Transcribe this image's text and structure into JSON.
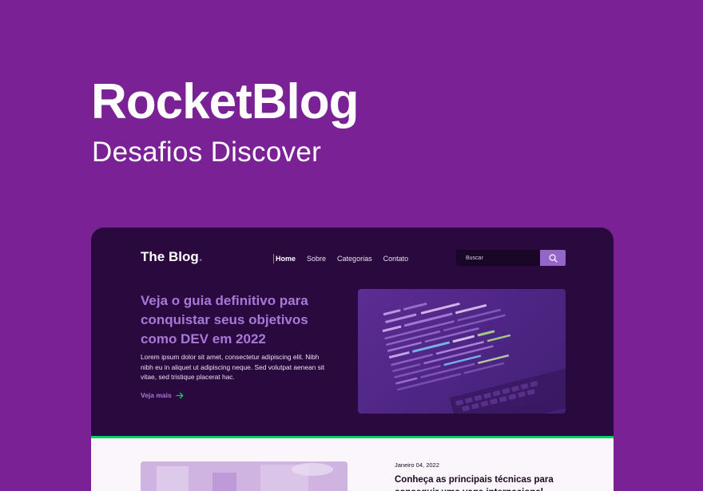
{
  "hero": {
    "title": "RocketBlog",
    "subtitle": "Desafios Discover"
  },
  "blog": {
    "logo": "The Blog",
    "logo_dot": ".",
    "nav": [
      {
        "label": "Home",
        "active": true
      },
      {
        "label": "Sobre",
        "active": false
      },
      {
        "label": "Categorias",
        "active": false
      },
      {
        "label": "Contato",
        "active": false
      }
    ],
    "search": {
      "placeholder": "Buscar"
    },
    "featured": {
      "headline": "Veja o guia definitivo para conquistar seus objetivos como DEV em 2022",
      "description": "Lorem ipsum dolor sit amet, consectetur adipiscing elit. Nibh nibh eu in aliquet ut adipiscing neque. Sed volutpat aenean sit vitae, sed tristique placerat hac.",
      "cta": "Veja mais"
    },
    "post": {
      "date": "Janeiro 04, 2022",
      "title": "Conheça as principais técnicas para conseguir uma vaga internacional"
    }
  },
  "colors": {
    "background": "#7b2196",
    "panel": "#2a0a3e",
    "accent_green": "#04d361",
    "accent_purple": "#a878d8"
  }
}
